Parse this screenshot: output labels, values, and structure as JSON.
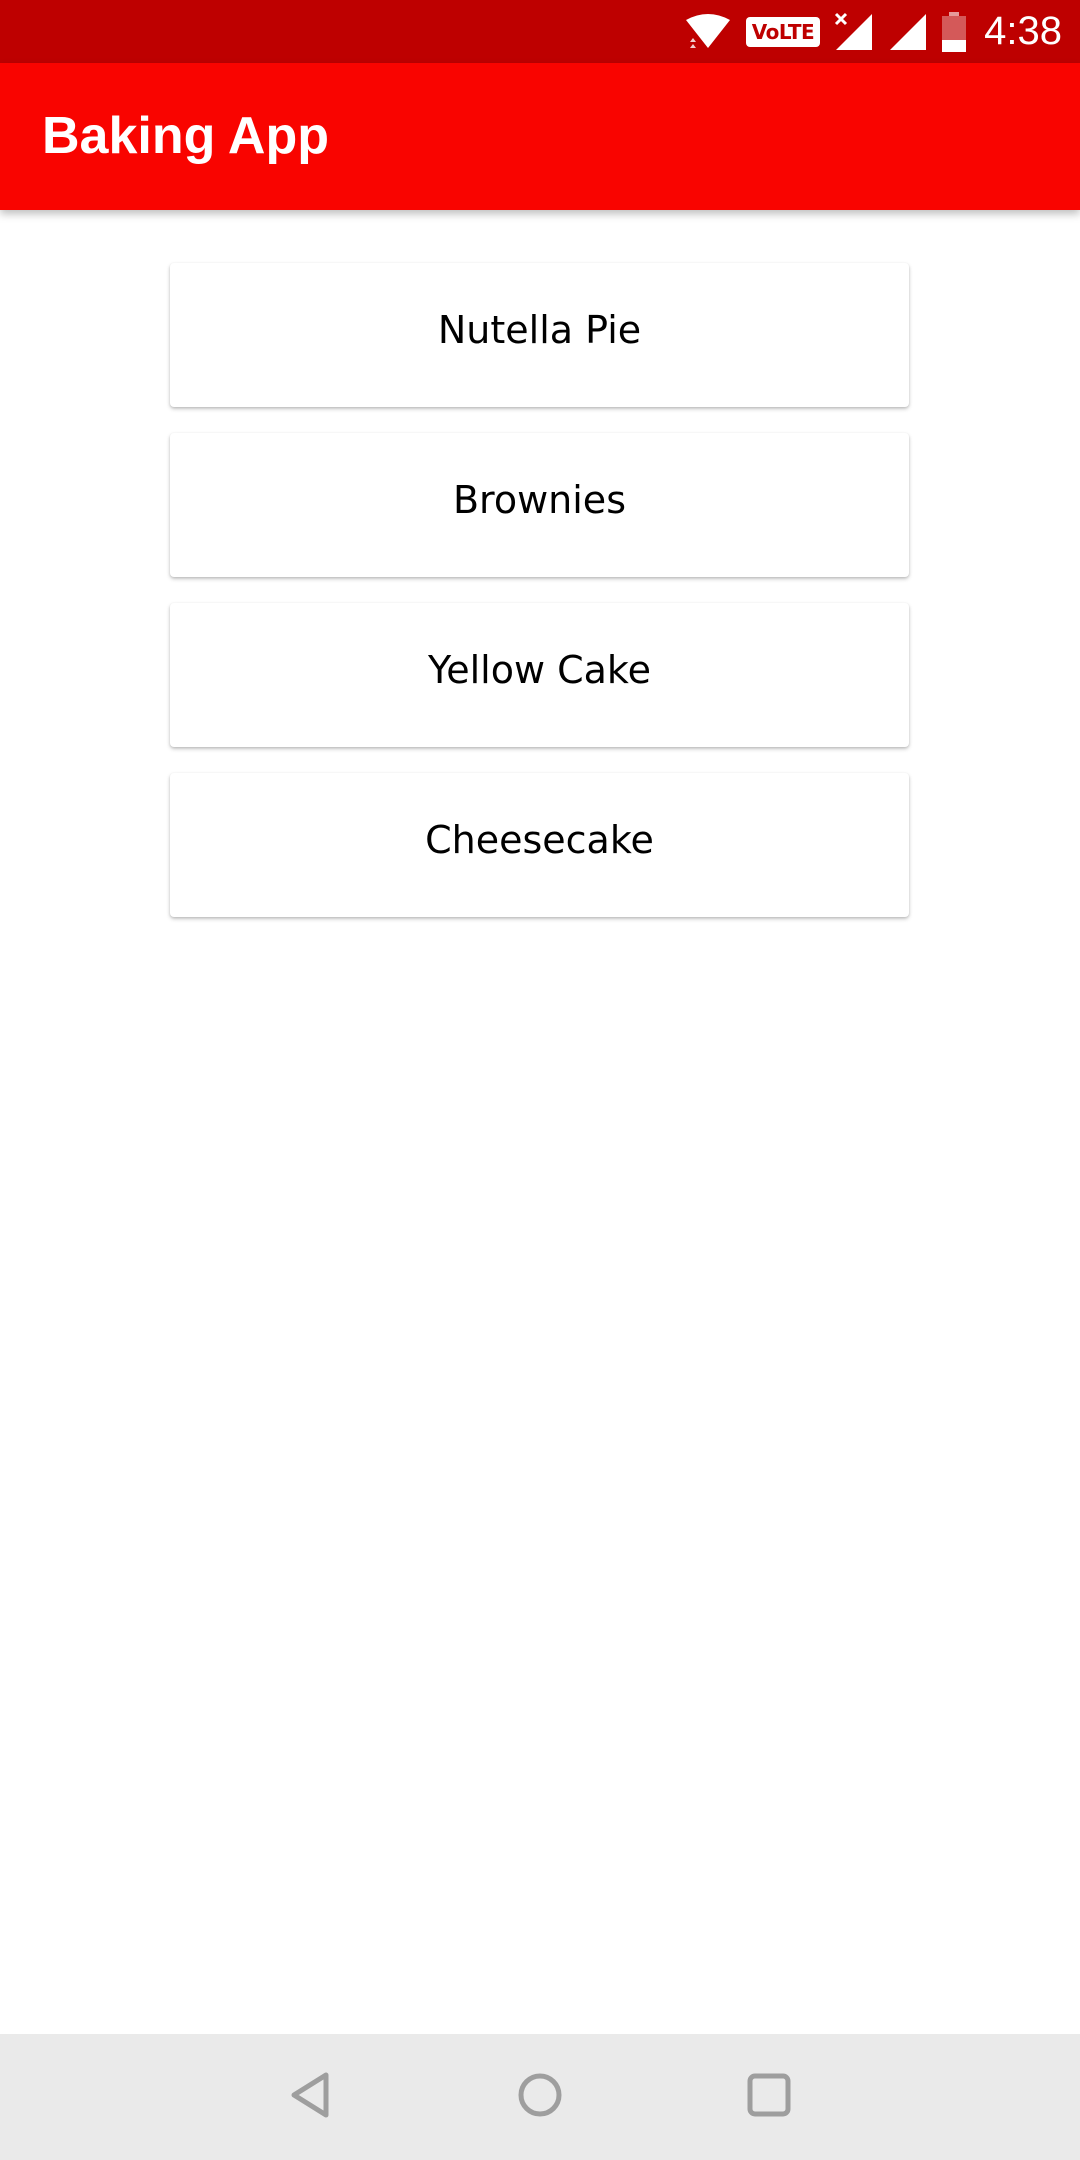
{
  "status_bar": {
    "time": "4:38",
    "volte_label": "VoLTE",
    "icons": [
      "wifi-icon",
      "volte-icon",
      "no-signal-icon",
      "signal-icon",
      "battery-low-icon"
    ],
    "background": "#BE0000"
  },
  "app_bar": {
    "title": "Baking App",
    "background": "#F90400"
  },
  "recipes": [
    {
      "name": "Nutella Pie"
    },
    {
      "name": "Brownies"
    },
    {
      "name": "Yellow Cake"
    },
    {
      "name": "Cheesecake"
    }
  ],
  "nav_bar": {
    "icons": [
      "back-icon",
      "home-icon",
      "recents-icon"
    ],
    "background": "#EAEAEA",
    "icon_color": "#9E9E9E"
  }
}
